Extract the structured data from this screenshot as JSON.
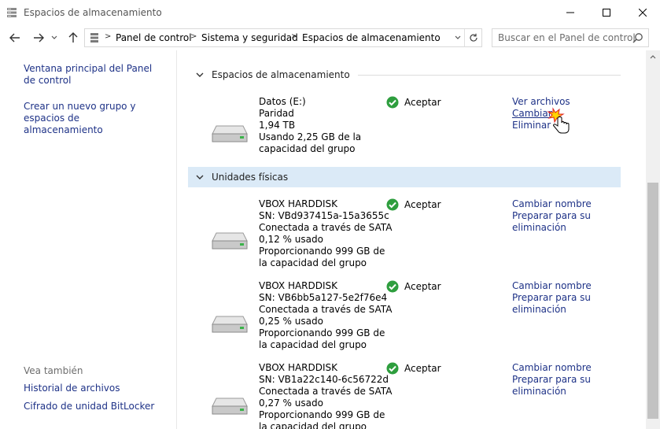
{
  "window": {
    "title": "Espacios de almacenamiento"
  },
  "address": {
    "crumbs": [
      "Panel de control",
      "Sistema y seguridad",
      "Espacios de almacenamiento"
    ],
    "search_placeholder": "Buscar en el Panel de control"
  },
  "left_pane": {
    "links": [
      "Ventana principal del Panel de control",
      "Crear un nuevo grupo y espacios de almacenamiento"
    ],
    "see_also_label": "Vea también",
    "see_also_links": [
      "Historial de archivos",
      "Cifrado de unidad BitLocker"
    ]
  },
  "storage_spaces": {
    "header": "Espacios de almacenamiento",
    "items": [
      {
        "lines": [
          "Datos (E:)",
          "Paridad",
          "1,94 TB",
          "Usando 2,25 GB de la",
          "capacidad del grupo"
        ],
        "status": "Aceptar",
        "actions": [
          "Ver archivos",
          "Cambiar",
          "Eliminar"
        ]
      }
    ]
  },
  "physical_drives": {
    "header": "Unidades físicas",
    "items": [
      {
        "lines": [
          "VBOX HARDDISK",
          "SN: VBd937415a-15a3655c",
          "Conectada a través de SATA",
          "0,12 % usado",
          "Proporcionando 999 GB de",
          "la capacidad del grupo"
        ],
        "status": "Aceptar",
        "actions": [
          "Cambiar nombre",
          "Preparar para su",
          "eliminación"
        ]
      },
      {
        "lines": [
          "VBOX HARDDISK",
          "SN: VB6bb5a127-5e2f76e4",
          "Conectada a través de SATA",
          "0,25 % usado",
          "Proporcionando 999 GB de",
          "la capacidad del grupo"
        ],
        "status": "Aceptar",
        "actions": [
          "Cambiar nombre",
          "Preparar para su",
          "eliminación"
        ]
      },
      {
        "lines": [
          "VBOX HARDDISK",
          "SN: VB1a22c140-6c56722d",
          "Conectada a través de SATA",
          "0,27 % usado",
          "Proporcionando 999 GB de",
          "la capacidad del grupo"
        ],
        "status": "Aceptar",
        "actions": [
          "Cambiar nombre",
          "Preparar para su",
          "eliminación"
        ]
      }
    ]
  },
  "colors": {
    "link": "#1e3287",
    "selected_header": "#dbeaf7",
    "ok_green": "#2e9e3e"
  },
  "icons": [
    "storage-spaces-icon",
    "back-arrow-icon",
    "forward-arrow-icon",
    "recent-dropdown-icon",
    "up-arrow-icon",
    "refresh-icon",
    "search-icon",
    "chevron-down-icon",
    "hard-drive-icon",
    "ok-check-icon",
    "hand-cursor-icon"
  ]
}
